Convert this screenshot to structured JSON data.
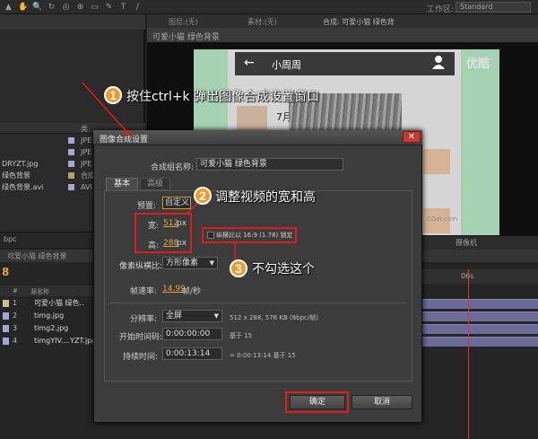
{
  "menubar": {
    "workspace_label": "工作区:",
    "workspace_value": "Standard"
  },
  "project": {
    "type_header": "类",
    "items": [
      {
        "name": "",
        "type": "JPE",
        "color": "#a8a4d8"
      },
      {
        "name": "",
        "type": "JPE",
        "color": "#a8a4d8"
      },
      {
        "name": "DRYZT.jpg",
        "type": "JPE",
        "color": "#a8a4d8"
      },
      {
        "name": "绿色背景",
        "type": "合成",
        "color": "#b3a07a"
      },
      {
        "name": "绿色背景.avi",
        "type": "AVI",
        "color": "#a8a4d8"
      }
    ],
    "footer_bpc": "bpc"
  },
  "comp": {
    "tabs": [
      "图层:(无)",
      "素材:(无)"
    ],
    "title_tab": "合成: 可爱小猫 绿色背",
    "panel_title": "可爱小猫 绿色背景",
    "phone_title": "小周周",
    "phone_back": "←",
    "chat_date": "7月",
    "youku": "优酷",
    "watermark": "CGer.com",
    "camera_label": "摄像机"
  },
  "timeline": {
    "title": "可爱小猫 绿色背景",
    "timecode": "8",
    "col_num": "#",
    "col_name": "源名称",
    "ruler_mark": "06s",
    "layers": [
      {
        "num": "1",
        "name": "可爱小猫 绿色..",
        "color": "#c8c18a"
      },
      {
        "num": "2",
        "name": "timg.jpg",
        "color": "#a8a4d8"
      },
      {
        "num": "3",
        "name": "timg2.jpg",
        "color": "#a8a4d8"
      },
      {
        "num": "4",
        "name": "timgYIV....YZT.jpg",
        "color": "#a8a4d8"
      }
    ]
  },
  "dialog": {
    "title": "图像合成设置",
    "close": "✕",
    "name_label": "合成组名称:",
    "name_value": "可爱小猫 绿色背景",
    "tab_basic": "基本",
    "tab_advanced": "高级",
    "preset_label": "预置:",
    "preset_value": "自定义",
    "width_label": "宽:",
    "width_value": "512",
    "width_unit": "px",
    "height_label": "高:",
    "height_value": "288",
    "height_unit": "px",
    "lock_label": "纵横比以 16:9 (1.78) 锁定",
    "lock_checked": false,
    "par_label": "像素纵横比:",
    "par_value": "方形像素",
    "fps_label": "帧速率:",
    "fps_value": "14.99",
    "fps_unit": "帧/秒",
    "res_label": "分辨率:",
    "res_value": "全屏",
    "res_info": "512 x 288, 576 KB (8bpc/帧)",
    "start_label": "开始时间码:",
    "start_value": "0:00:00:00",
    "start_base": "基于 15",
    "dur_label": "持续时间:",
    "dur_value": "0:00:13:14",
    "dur_info": "= 0:00:13:14   基于 15",
    "ok": "确定",
    "cancel": "取消"
  },
  "annotations": [
    {
      "num": "1",
      "text": "按住ctrl+k 弹出图像合成设置窗口"
    },
    {
      "num": "2",
      "text": "调整视频的宽和高"
    },
    {
      "num": "3",
      "text": "不勾选这个"
    }
  ],
  "colors": {
    "accent_orange": "#e8a23b",
    "annotation_red": "#e01c1c",
    "step_badge": "#f19b2c",
    "green_screen": "#a6d2b4"
  }
}
